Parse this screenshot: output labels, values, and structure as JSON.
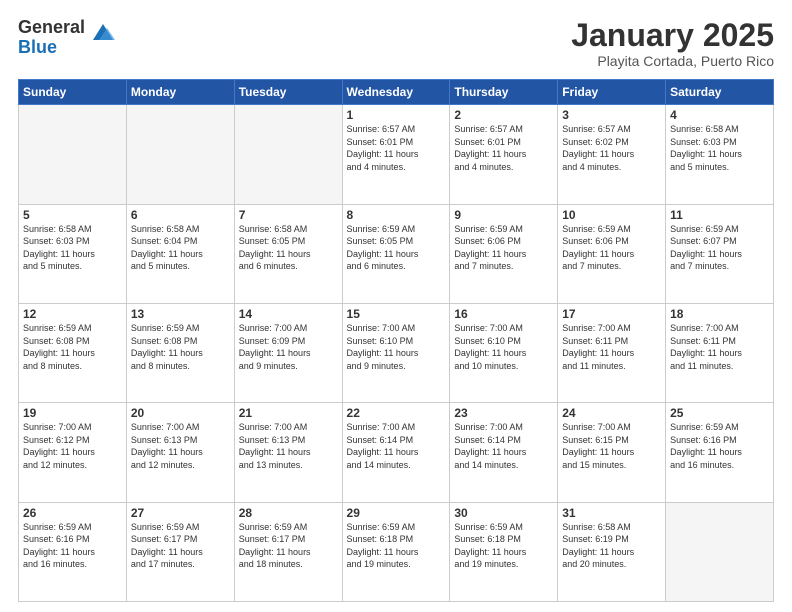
{
  "logo": {
    "general": "General",
    "blue": "Blue"
  },
  "header": {
    "month": "January 2025",
    "location": "Playita Cortada, Puerto Rico"
  },
  "weekdays": [
    "Sunday",
    "Monday",
    "Tuesday",
    "Wednesday",
    "Thursday",
    "Friday",
    "Saturday"
  ],
  "weeks": [
    [
      {
        "day": "",
        "info": ""
      },
      {
        "day": "",
        "info": ""
      },
      {
        "day": "",
        "info": ""
      },
      {
        "day": "1",
        "info": "Sunrise: 6:57 AM\nSunset: 6:01 PM\nDaylight: 11 hours\nand 4 minutes."
      },
      {
        "day": "2",
        "info": "Sunrise: 6:57 AM\nSunset: 6:01 PM\nDaylight: 11 hours\nand 4 minutes."
      },
      {
        "day": "3",
        "info": "Sunrise: 6:57 AM\nSunset: 6:02 PM\nDaylight: 11 hours\nand 4 minutes."
      },
      {
        "day": "4",
        "info": "Sunrise: 6:58 AM\nSunset: 6:03 PM\nDaylight: 11 hours\nand 5 minutes."
      }
    ],
    [
      {
        "day": "5",
        "info": "Sunrise: 6:58 AM\nSunset: 6:03 PM\nDaylight: 11 hours\nand 5 minutes."
      },
      {
        "day": "6",
        "info": "Sunrise: 6:58 AM\nSunset: 6:04 PM\nDaylight: 11 hours\nand 5 minutes."
      },
      {
        "day": "7",
        "info": "Sunrise: 6:58 AM\nSunset: 6:05 PM\nDaylight: 11 hours\nand 6 minutes."
      },
      {
        "day": "8",
        "info": "Sunrise: 6:59 AM\nSunset: 6:05 PM\nDaylight: 11 hours\nand 6 minutes."
      },
      {
        "day": "9",
        "info": "Sunrise: 6:59 AM\nSunset: 6:06 PM\nDaylight: 11 hours\nand 7 minutes."
      },
      {
        "day": "10",
        "info": "Sunrise: 6:59 AM\nSunset: 6:06 PM\nDaylight: 11 hours\nand 7 minutes."
      },
      {
        "day": "11",
        "info": "Sunrise: 6:59 AM\nSunset: 6:07 PM\nDaylight: 11 hours\nand 7 minutes."
      }
    ],
    [
      {
        "day": "12",
        "info": "Sunrise: 6:59 AM\nSunset: 6:08 PM\nDaylight: 11 hours\nand 8 minutes."
      },
      {
        "day": "13",
        "info": "Sunrise: 6:59 AM\nSunset: 6:08 PM\nDaylight: 11 hours\nand 8 minutes."
      },
      {
        "day": "14",
        "info": "Sunrise: 7:00 AM\nSunset: 6:09 PM\nDaylight: 11 hours\nand 9 minutes."
      },
      {
        "day": "15",
        "info": "Sunrise: 7:00 AM\nSunset: 6:10 PM\nDaylight: 11 hours\nand 9 minutes."
      },
      {
        "day": "16",
        "info": "Sunrise: 7:00 AM\nSunset: 6:10 PM\nDaylight: 11 hours\nand 10 minutes."
      },
      {
        "day": "17",
        "info": "Sunrise: 7:00 AM\nSunset: 6:11 PM\nDaylight: 11 hours\nand 11 minutes."
      },
      {
        "day": "18",
        "info": "Sunrise: 7:00 AM\nSunset: 6:11 PM\nDaylight: 11 hours\nand 11 minutes."
      }
    ],
    [
      {
        "day": "19",
        "info": "Sunrise: 7:00 AM\nSunset: 6:12 PM\nDaylight: 11 hours\nand 12 minutes."
      },
      {
        "day": "20",
        "info": "Sunrise: 7:00 AM\nSunset: 6:13 PM\nDaylight: 11 hours\nand 12 minutes."
      },
      {
        "day": "21",
        "info": "Sunrise: 7:00 AM\nSunset: 6:13 PM\nDaylight: 11 hours\nand 13 minutes."
      },
      {
        "day": "22",
        "info": "Sunrise: 7:00 AM\nSunset: 6:14 PM\nDaylight: 11 hours\nand 14 minutes."
      },
      {
        "day": "23",
        "info": "Sunrise: 7:00 AM\nSunset: 6:14 PM\nDaylight: 11 hours\nand 14 minutes."
      },
      {
        "day": "24",
        "info": "Sunrise: 7:00 AM\nSunset: 6:15 PM\nDaylight: 11 hours\nand 15 minutes."
      },
      {
        "day": "25",
        "info": "Sunrise: 6:59 AM\nSunset: 6:16 PM\nDaylight: 11 hours\nand 16 minutes."
      }
    ],
    [
      {
        "day": "26",
        "info": "Sunrise: 6:59 AM\nSunset: 6:16 PM\nDaylight: 11 hours\nand 16 minutes."
      },
      {
        "day": "27",
        "info": "Sunrise: 6:59 AM\nSunset: 6:17 PM\nDaylight: 11 hours\nand 17 minutes."
      },
      {
        "day": "28",
        "info": "Sunrise: 6:59 AM\nSunset: 6:17 PM\nDaylight: 11 hours\nand 18 minutes."
      },
      {
        "day": "29",
        "info": "Sunrise: 6:59 AM\nSunset: 6:18 PM\nDaylight: 11 hours\nand 19 minutes."
      },
      {
        "day": "30",
        "info": "Sunrise: 6:59 AM\nSunset: 6:18 PM\nDaylight: 11 hours\nand 19 minutes."
      },
      {
        "day": "31",
        "info": "Sunrise: 6:58 AM\nSunset: 6:19 PM\nDaylight: 11 hours\nand 20 minutes."
      },
      {
        "day": "",
        "info": ""
      }
    ]
  ]
}
